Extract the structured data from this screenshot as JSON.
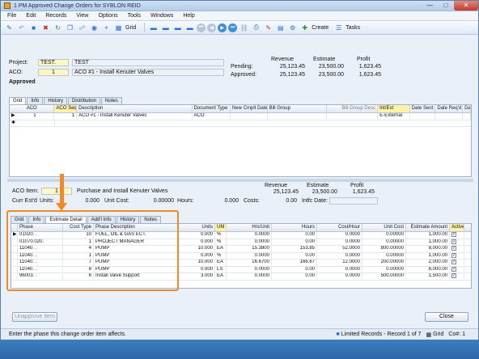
{
  "window": {
    "title": "1 PM Approved Change Orders for SYBLON REID",
    "controls": [
      "minimize-icon",
      "maximize-icon",
      "close-icon"
    ]
  },
  "menu": [
    "File",
    "Edit",
    "Records",
    "View",
    "Options",
    "Tools",
    "Windows",
    "Help"
  ],
  "toolbar": {
    "grid_label": "Grid",
    "create_label": "Create",
    "tasks_label": "Tasks"
  },
  "header": {
    "project_label": "Project:",
    "project_value": "TEST.",
    "project_desc": "TEST",
    "aco_label": "ACO:",
    "aco_value": "1",
    "aco_desc": "ACO #1 - Install Kenuter Valves",
    "status": "Approved",
    "revenue_label": "Revenue",
    "estimate_label": "Estimate",
    "profit_label": "Profit",
    "pending_label": "Pending:",
    "approved_label": "Approved:",
    "pending_revenue": "25,123.45",
    "pending_estimate": "23,500.00",
    "pending_profit": "1,623.45",
    "approved_revenue": "25,123.45",
    "approved_estimate": "23,500.00",
    "approved_profit": "1,623.45"
  },
  "top_tabs": [
    "Grid",
    "Info",
    "History",
    "Distribution",
    "Notes"
  ],
  "aco_grid": {
    "columns": [
      "ACO",
      "ACO Seq",
      "Description",
      "Document Type",
      "New Cmplt Date",
      "Bill Group",
      "Bill Group Desc",
      "Int/Ext",
      "Date Sent",
      "Date Req'd",
      "Da"
    ],
    "rows": [
      [
        "1",
        "1",
        "ACO #1 - Install Kenuter Valves",
        "ACO",
        "",
        "",
        "",
        "E-External",
        "",
        "",
        ""
      ]
    ]
  },
  "item": {
    "aco_item_label": "ACO Item:",
    "aco_item_value": "1",
    "aco_item_desc": "Purchase and Install Kenuter Valves",
    "curr_est_label": "Curr Est'd",
    "units_label": "Units:",
    "units_value": "0.000",
    "unit_cost_label": "Unit Cost:",
    "unit_cost_value": "0.00000",
    "hours_label": "Hours:",
    "hours_value": "0.000",
    "costs_label": "Costs:",
    "costs_value": "0.00",
    "intfc_label": "Intfc Date:",
    "revenue_label": "Revenue",
    "estimate_label": "Estimate",
    "profit_label": "Profit",
    "revenue": "25,123.45",
    "estimate": "23,500.00",
    "profit": "1,623.45"
  },
  "bottom_tabs": [
    "Grid",
    "Info",
    "Estimate Detail",
    "Add'l Info",
    "History",
    "Notes"
  ],
  "detail_grid": {
    "columns": [
      "Phase",
      "Cost Type",
      "Phase Description",
      "Units",
      "UM",
      "Hrs/Unit",
      "Hours",
      "Cost/Hour",
      "Unit Cost",
      "Estimate Amount",
      "Active"
    ],
    "rows": [
      [
        "01020.  .",
        "10",
        "FUEL, OIL & GAS ECT.",
        "0.000",
        "%",
        "0.0000",
        "0.00",
        "0.0000",
        "0.00000",
        "1,000.00"
      ],
      [
        "01070.020.",
        "1",
        "PROJECT MANAGER",
        "0.000",
        "%",
        "0.0000",
        "0.00",
        "0.0000",
        "0.00000",
        "1,000.00"
      ],
      [
        "11040.  .",
        "4",
        "PUMP",
        "10.000",
        "EA",
        "15.3800",
        "153.85",
        "52.0000",
        "800.00000",
        "8,000.00"
      ],
      [
        "11040.  .",
        "1",
        "PUMP",
        "0.000",
        "%",
        "0.0000",
        "0.00",
        "0.0000",
        "0.00000",
        "1,000.00"
      ],
      [
        "11040.  .",
        "7",
        "PUMP",
        "10.000",
        "EA",
        "16.6700",
        "166.67",
        "12.0000",
        "200.00000",
        "2,000.00"
      ],
      [
        "11040.  .",
        "8",
        "PUMP",
        "0.000",
        "LS",
        "0.0000",
        "0.00",
        "0.0000",
        "0.00000",
        "8,000.00"
      ],
      [
        "96003.  .",
        "6",
        "Install Valve Support",
        "3.000",
        "EA",
        "0.0000",
        "0.00",
        "0.0000",
        "500.00000",
        "1,500.00"
      ]
    ]
  },
  "buttons": {
    "unapprove": "Unapprove Item",
    "close": "Close"
  },
  "statusbar": {
    "hint": "Enter the phase this change order item affects.",
    "records": "Limited Records - Record 1 of 7",
    "mode": "Grid",
    "co": "Co#: 1"
  },
  "colors": {
    "callout": "#f08a24",
    "highlight": "#fff2a8"
  }
}
